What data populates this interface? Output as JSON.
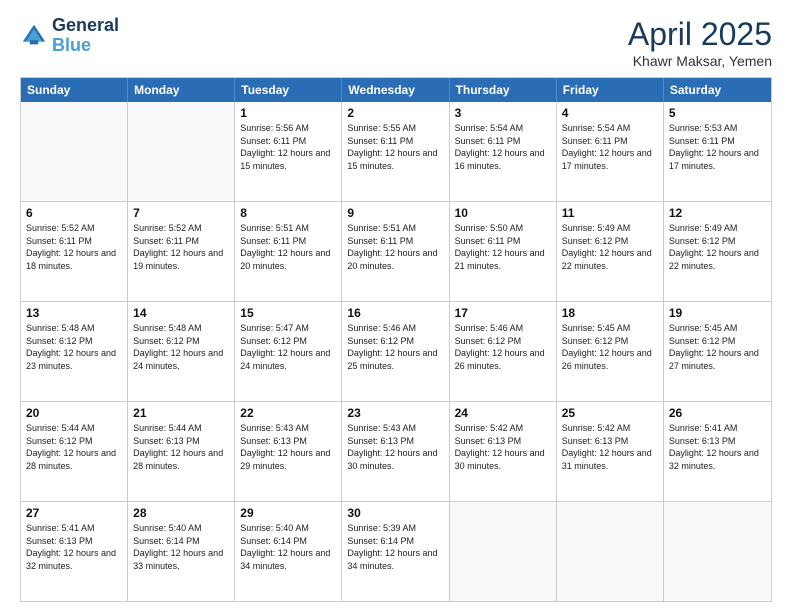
{
  "header": {
    "logo_line1": "General",
    "logo_line2": "Blue",
    "month_title": "April 2025",
    "location": "Khawr Maksar, Yemen"
  },
  "weekdays": [
    "Sunday",
    "Monday",
    "Tuesday",
    "Wednesday",
    "Thursday",
    "Friday",
    "Saturday"
  ],
  "weeks": [
    [
      {
        "day": "",
        "empty": true
      },
      {
        "day": "",
        "empty": true
      },
      {
        "day": "1",
        "sunrise": "5:56 AM",
        "sunset": "6:11 PM",
        "daylight": "12 hours and 15 minutes."
      },
      {
        "day": "2",
        "sunrise": "5:55 AM",
        "sunset": "6:11 PM",
        "daylight": "12 hours and 15 minutes."
      },
      {
        "day": "3",
        "sunrise": "5:54 AM",
        "sunset": "6:11 PM",
        "daylight": "12 hours and 16 minutes."
      },
      {
        "day": "4",
        "sunrise": "5:54 AM",
        "sunset": "6:11 PM",
        "daylight": "12 hours and 17 minutes."
      },
      {
        "day": "5",
        "sunrise": "5:53 AM",
        "sunset": "6:11 PM",
        "daylight": "12 hours and 17 minutes."
      }
    ],
    [
      {
        "day": "6",
        "sunrise": "5:52 AM",
        "sunset": "6:11 PM",
        "daylight": "12 hours and 18 minutes."
      },
      {
        "day": "7",
        "sunrise": "5:52 AM",
        "sunset": "6:11 PM",
        "daylight": "12 hours and 19 minutes."
      },
      {
        "day": "8",
        "sunrise": "5:51 AM",
        "sunset": "6:11 PM",
        "daylight": "12 hours and 20 minutes."
      },
      {
        "day": "9",
        "sunrise": "5:51 AM",
        "sunset": "6:11 PM",
        "daylight": "12 hours and 20 minutes."
      },
      {
        "day": "10",
        "sunrise": "5:50 AM",
        "sunset": "6:11 PM",
        "daylight": "12 hours and 21 minutes."
      },
      {
        "day": "11",
        "sunrise": "5:49 AM",
        "sunset": "6:12 PM",
        "daylight": "12 hours and 22 minutes."
      },
      {
        "day": "12",
        "sunrise": "5:49 AM",
        "sunset": "6:12 PM",
        "daylight": "12 hours and 22 minutes."
      }
    ],
    [
      {
        "day": "13",
        "sunrise": "5:48 AM",
        "sunset": "6:12 PM",
        "daylight": "12 hours and 23 minutes."
      },
      {
        "day": "14",
        "sunrise": "5:48 AM",
        "sunset": "6:12 PM",
        "daylight": "12 hours and 24 minutes."
      },
      {
        "day": "15",
        "sunrise": "5:47 AM",
        "sunset": "6:12 PM",
        "daylight": "12 hours and 24 minutes."
      },
      {
        "day": "16",
        "sunrise": "5:46 AM",
        "sunset": "6:12 PM",
        "daylight": "12 hours and 25 minutes."
      },
      {
        "day": "17",
        "sunrise": "5:46 AM",
        "sunset": "6:12 PM",
        "daylight": "12 hours and 26 minutes."
      },
      {
        "day": "18",
        "sunrise": "5:45 AM",
        "sunset": "6:12 PM",
        "daylight": "12 hours and 26 minutes."
      },
      {
        "day": "19",
        "sunrise": "5:45 AM",
        "sunset": "6:12 PM",
        "daylight": "12 hours and 27 minutes."
      }
    ],
    [
      {
        "day": "20",
        "sunrise": "5:44 AM",
        "sunset": "6:12 PM",
        "daylight": "12 hours and 28 minutes."
      },
      {
        "day": "21",
        "sunrise": "5:44 AM",
        "sunset": "6:13 PM",
        "daylight": "12 hours and 28 minutes."
      },
      {
        "day": "22",
        "sunrise": "5:43 AM",
        "sunset": "6:13 PM",
        "daylight": "12 hours and 29 minutes."
      },
      {
        "day": "23",
        "sunrise": "5:43 AM",
        "sunset": "6:13 PM",
        "daylight": "12 hours and 30 minutes."
      },
      {
        "day": "24",
        "sunrise": "5:42 AM",
        "sunset": "6:13 PM",
        "daylight": "12 hours and 30 minutes."
      },
      {
        "day": "25",
        "sunrise": "5:42 AM",
        "sunset": "6:13 PM",
        "daylight": "12 hours and 31 minutes."
      },
      {
        "day": "26",
        "sunrise": "5:41 AM",
        "sunset": "6:13 PM",
        "daylight": "12 hours and 32 minutes."
      }
    ],
    [
      {
        "day": "27",
        "sunrise": "5:41 AM",
        "sunset": "6:13 PM",
        "daylight": "12 hours and 32 minutes."
      },
      {
        "day": "28",
        "sunrise": "5:40 AM",
        "sunset": "6:14 PM",
        "daylight": "12 hours and 33 minutes."
      },
      {
        "day": "29",
        "sunrise": "5:40 AM",
        "sunset": "6:14 PM",
        "daylight": "12 hours and 34 minutes."
      },
      {
        "day": "30",
        "sunrise": "5:39 AM",
        "sunset": "6:14 PM",
        "daylight": "12 hours and 34 minutes."
      },
      {
        "day": "",
        "empty": true
      },
      {
        "day": "",
        "empty": true
      },
      {
        "day": "",
        "empty": true
      }
    ]
  ]
}
